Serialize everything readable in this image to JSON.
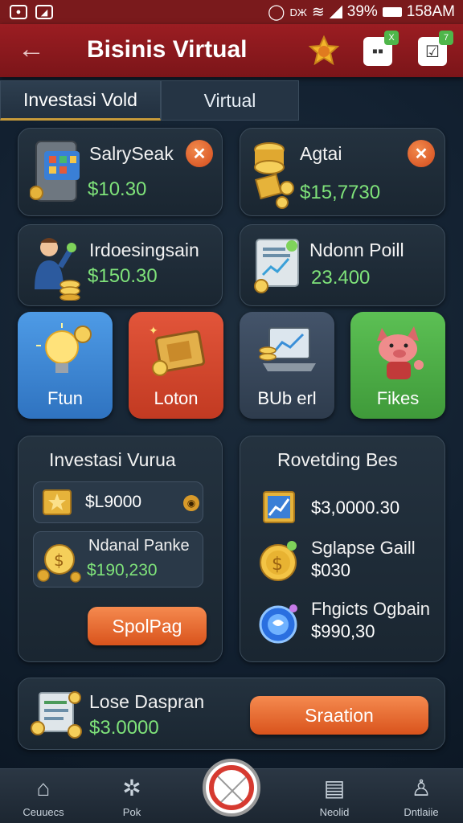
{
  "status_bar": {
    "battery": "39%",
    "time": "158AM"
  },
  "app_bar": {
    "title": "Bisinis Virtual",
    "back_icon": "arrow-left-icon",
    "checklist_badge_1": "X",
    "checklist_badge_2": "7"
  },
  "tabs": [
    {
      "label": "Investasi Vold"
    },
    {
      "label": "Virtual"
    }
  ],
  "cards": [
    {
      "name": "SalrySeak",
      "value": "$10.30"
    },
    {
      "name": "Agtai",
      "value": "$15,7730"
    },
    {
      "name": "Irdoesingsain",
      "value": "$150.30"
    },
    {
      "name": "Ndonn Poill",
      "value": "23.400"
    }
  ],
  "tiles": [
    {
      "label": "Ftun",
      "color": "#3b86d4"
    },
    {
      "label": "Loton",
      "color": "#d64a2d"
    },
    {
      "label": "BUb erl",
      "color": "#3a4858"
    },
    {
      "label": "Fikes",
      "color": "#4fb149"
    }
  ],
  "panel_left": {
    "title": "Investasi Vurua",
    "row1_value": "$L9000",
    "row2_name": "Ndanal Panke",
    "row2_value": "$190,230",
    "button": "SpolPag"
  },
  "panel_right": {
    "title": "Rovetding Bes",
    "items": [
      {
        "name": "",
        "value": "$3,0000.30"
      },
      {
        "name": "Sglapse Gaill",
        "value": "$030"
      },
      {
        "name": "Fhgicts Ogbain",
        "value": "$990,30"
      }
    ]
  },
  "bottom_card": {
    "name": "Lose Daspran",
    "value": "$3.0000",
    "button": "Sraation"
  },
  "nav": [
    {
      "label": "Ceuuecs",
      "icon": "home-icon"
    },
    {
      "label": "Pok",
      "icon": "gear-icon"
    },
    {
      "label": "Neolid",
      "icon": "device-icon"
    },
    {
      "label": "Dntlaiie",
      "icon": "user-icon"
    }
  ]
}
